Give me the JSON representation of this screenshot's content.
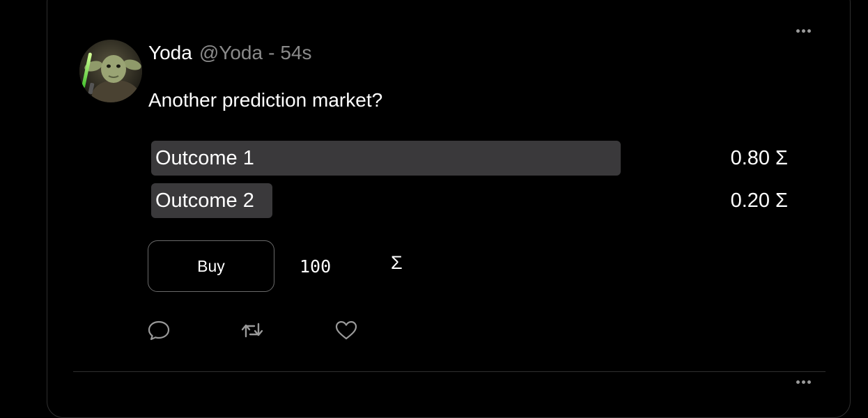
{
  "post": {
    "author_name": "Yoda",
    "author_handle": "@Yoda",
    "separator": "-",
    "age": "54s",
    "text": "Another prediction market?",
    "more_icon": "more-horizontal-icon",
    "avatar_icon": "yoda-avatar"
  },
  "market": {
    "outcomes": [
      {
        "label": "Outcome 1",
        "price": "0.80 Σ",
        "share": 0.8
      },
      {
        "label": "Outcome 2",
        "price": "0.20 Σ",
        "share": 0.2
      }
    ],
    "buy_label": "Buy",
    "amount": "100",
    "currency_symbol": "Σ"
  },
  "actions": {
    "reply_icon": "comment-icon",
    "repost_icon": "retweet-icon",
    "like_icon": "heart-icon"
  },
  "colors": {
    "background": "#000000",
    "outcome_bar": "#3a393b",
    "border": "#2f2f2f",
    "muted_text": "#8a8a8a"
  }
}
